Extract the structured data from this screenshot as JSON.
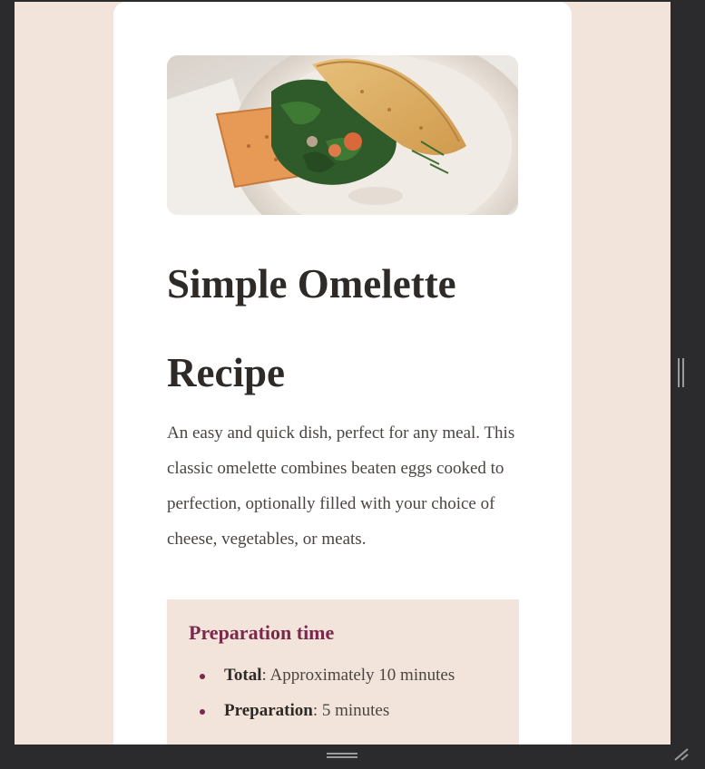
{
  "recipe": {
    "image_alt": "Omelette on a plate with spinach and toast",
    "title": "Simple Omelette Recipe",
    "description": "An easy and quick dish, perfect for any meal. This classic omelette combines beaten eggs cooked to perfection, optionally filled with your choice of cheese, vegetables, or meats."
  },
  "preparation": {
    "heading": "Preparation time",
    "items": [
      {
        "label": "Total",
        "value": ": Approximately 10 minutes"
      },
      {
        "label": "Preparation",
        "value": ": 5 minutes"
      }
    ]
  },
  "colors": {
    "page_background": "#f2e4da",
    "card_background": "#ffffff",
    "accent": "#7a284b",
    "frame": "#2b2b2d"
  },
  "icons": [
    "vertical-resize-handle-icon",
    "horizontal-resize-handle-icon",
    "resize-corner-grip-icon"
  ]
}
